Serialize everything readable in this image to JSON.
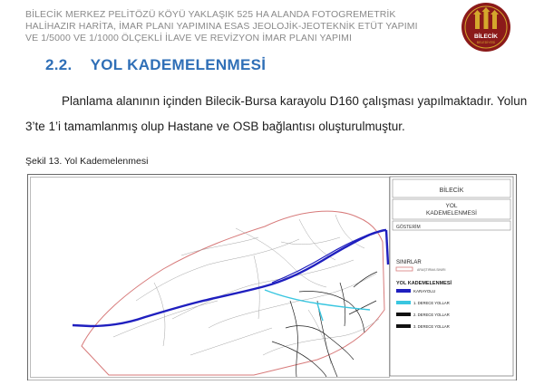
{
  "header": {
    "line1": "BİLECİK MERKEZ PELİTÖZÜ KÖYÜ YAKLAŞIK 525 HA ALANDA FOTOGREMETRİK",
    "line2": "HALİHAZIR HARİTA, İMAR PLANI YAPIMINA ESAS JEOLOJİK-JEOTEKNİK ETÜT YAPIMI",
    "line3": "VE 1/5000 VE 1/1000 ÖLÇEKLİ İLAVE VE REVİZYON İMAR PLANI YAPIMI"
  },
  "logo": {
    "text": "BİLECİK",
    "subtext": "BELEDİYESİ",
    "color": "#8b1a1a",
    "accent": "#d4a72c"
  },
  "section": {
    "number": "2.2.",
    "title": "YOL KADEMELENMESİ"
  },
  "paragraph": {
    "line1": "Planlama alanının içinden Bilecik-Bursa karayolu D160 çalışması yapılmaktadır. Yolun",
    "line2": "3’te 1’i tamamlanmış olup Hastane ve OSB bağlantısı oluşturulmuştur."
  },
  "figure": {
    "caption": "Şekil 13. Yol Kademelenmesi",
    "legend": {
      "place": "BİLECİK",
      "title_line1": "YOL",
      "title_line2": "KADEMELENMESİ",
      "gosterim": "GÖSTERİM",
      "sinirlar": "SINIRLAR",
      "sinir_item": "ARAŞTIRMA SINIRI",
      "kademe_title": "YOL KADEMELENMESİ",
      "items": [
        {
          "label": "KARAYOLU",
          "color": "#1f1fbf"
        },
        {
          "label": "1. DERECE YOLLAR",
          "color": "#39c6e0"
        },
        {
          "label": "2. DERECE YOLLAR",
          "color": "#111111"
        },
        {
          "label": "3. DERECE YOLLAR",
          "color": "#111111"
        }
      ]
    },
    "colors": {
      "highway": "#1f1fbf",
      "first_degree": "#39c6e0",
      "boundary": "#d77a7a"
    }
  }
}
